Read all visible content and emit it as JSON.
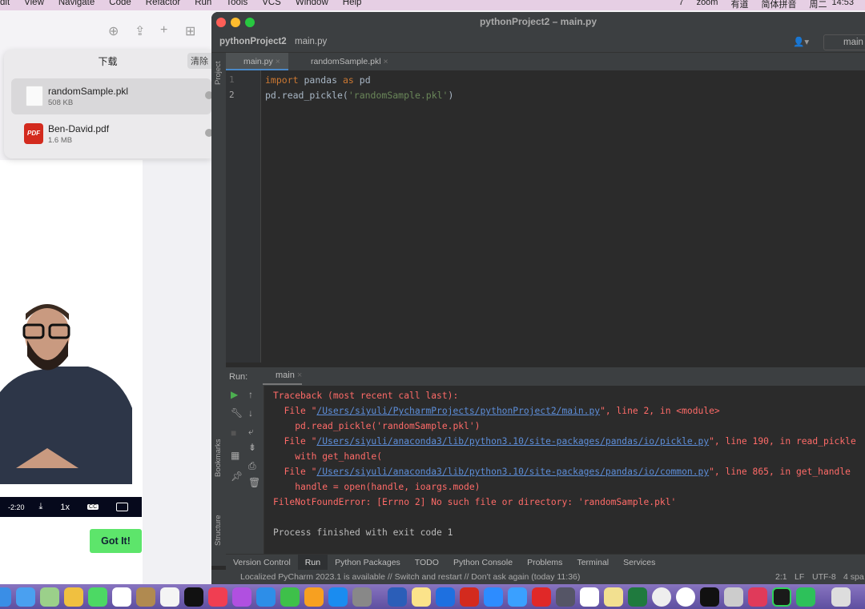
{
  "menubar": {
    "items": [
      "dit",
      "View",
      "Navigate",
      "Code",
      "Refactor",
      "Run",
      "Tools",
      "VCS",
      "Window",
      "Help"
    ],
    "status": [
      "7",
      "zoom",
      "有道",
      "简体拼音",
      "周二",
      "14:53"
    ]
  },
  "downloads": {
    "title": "下载",
    "clear": "清除",
    "items": [
      {
        "name": "randomSample.pkl",
        "size": "508 KB",
        "icon": "document-icon"
      },
      {
        "name": "Ben-David.pdf",
        "size": "1.6 MB",
        "icon": "pdf-icon"
      }
    ]
  },
  "video": {
    "time": "-2:20",
    "speed": "1x",
    "cc": "CC"
  },
  "page": {
    "got_it": "Got It!"
  },
  "pycharm": {
    "title": "pythonProject2 – main.py",
    "breadcrumb": [
      "pythonProject2",
      "main.py"
    ],
    "run_config": "main",
    "tabs": [
      "main.py",
      "randomSample.pkl"
    ],
    "left_tool": "Project",
    "code": {
      "line_numbers": [
        "1",
        "2"
      ],
      "line1": {
        "kw1": "import",
        "mod": "pandas",
        "kw2": "as",
        "alias": "pd"
      },
      "line2": {
        "pre": "pd.read_pickle(",
        "str": "'randomSample.pkl'",
        "post": ")"
      }
    },
    "run": {
      "label": "Run:",
      "tab": "main"
    },
    "side_tools": [
      "Bookmarks",
      "Structure"
    ],
    "console": {
      "l1": "Traceback (most recent call last):",
      "l2a": "  File \"",
      "l2link": "/Users/siyuli/PycharmProjects/pythonProject2/main.py",
      "l2b": "\", line 2, in <module>",
      "l3": "    pd.read_pickle('randomSample.pkl')",
      "l4a": "  File \"",
      "l4link": "/Users/siyuli/anaconda3/lib/python3.10/site-packages/pandas/io/pickle.py",
      "l4b": "\", line 190, in read_pickle",
      "l5": "    with get_handle(",
      "l6a": "  File \"",
      "l6link": "/Users/siyuli/anaconda3/lib/python3.10/site-packages/pandas/io/common.py",
      "l6b": "\", line 865, in get_handle",
      "l7": "    handle = open(handle, ioargs.mode)",
      "l8": "FileNotFoundError: [Errno 2] No such file or directory: 'randomSample.pkl'",
      "l9": "Process finished with exit code 1"
    },
    "tool_windows": [
      "Version Control",
      "Run",
      "Python Packages",
      "TODO",
      "Python Console",
      "Problems",
      "Terminal",
      "Services"
    ],
    "status": {
      "message": "Localized PyCharm 2023.1 is available // Switch and restart // Don't ask again (today 11:36)",
      "position": "2:1",
      "line_sep": "LF",
      "encoding": "UTF-8",
      "indent": "4 spa"
    }
  },
  "colors": {
    "accent_green": "#5de56b",
    "error": "#ff6b68",
    "link": "#5d8ed9"
  }
}
